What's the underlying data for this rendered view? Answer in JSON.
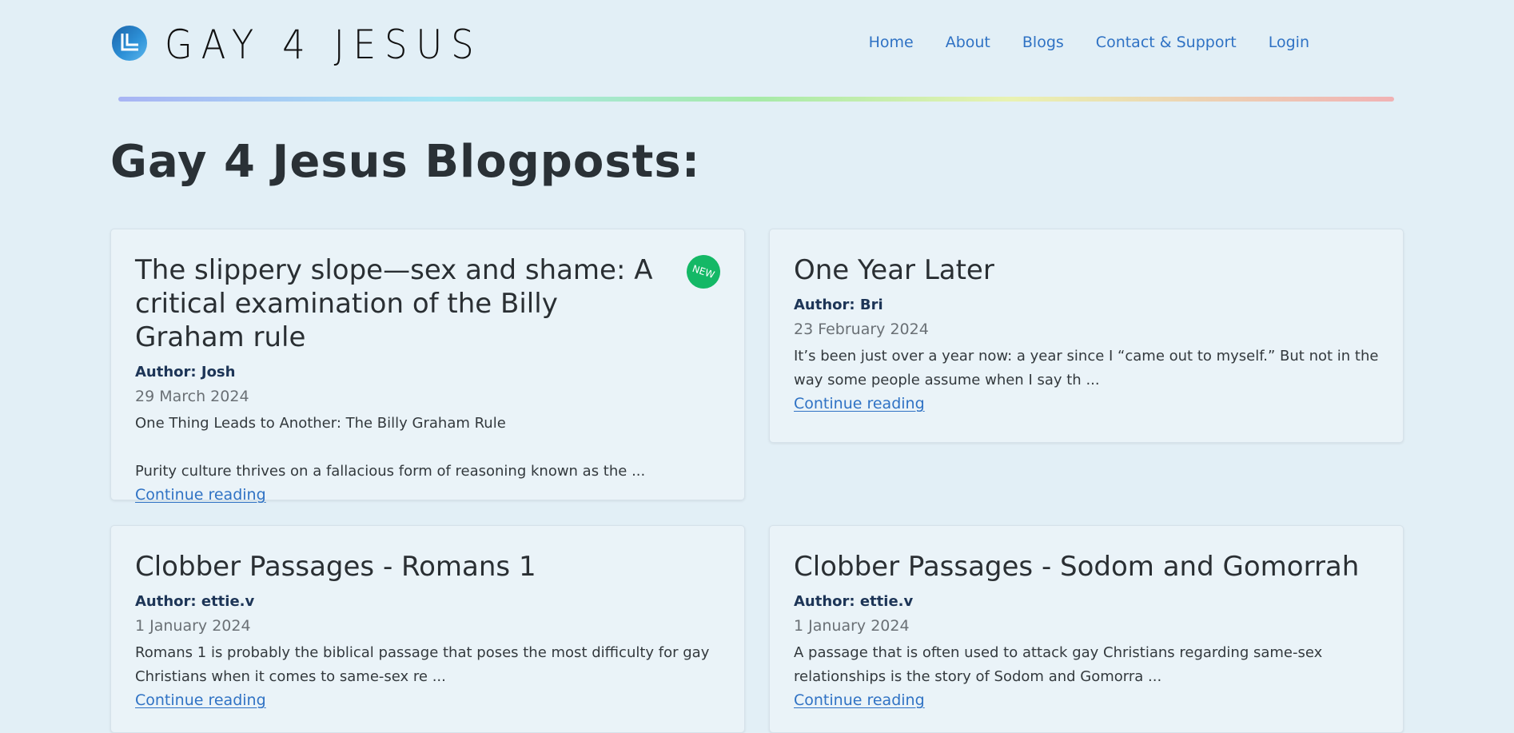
{
  "site": {
    "logo_text": "GAY 4 JESUS"
  },
  "nav": {
    "items": [
      {
        "label": "Home"
      },
      {
        "label": "About"
      },
      {
        "label": "Blogs"
      },
      {
        "label": "Contact & Support"
      },
      {
        "label": "Login"
      }
    ]
  },
  "page": {
    "title": "Gay 4 Jesus Blogposts:"
  },
  "posts": [
    {
      "title": "The slippery slope—sex and shame: A critical examination of the Billy Graham rule",
      "badge": "NEW",
      "author": "Author: Josh",
      "date": "29 March 2024",
      "excerpt": "One Thing Leads to Another: The Billy Graham Rule\n\nPurity culture thrives on a fallacious form of reasoning known as the ...",
      "link": "Continue reading"
    },
    {
      "title": "One Year Later",
      "author": "Author: Bri",
      "date": "23 February 2024",
      "excerpt": "It’s been just over a year now: a year since I “came out to myself.” But not in the way some people assume when I say th ...",
      "link": "Continue reading"
    },
    {
      "title": "Clobber Passages - Romans 1",
      "author": "Author: ettie.v",
      "date": "1 January 2024",
      "excerpt": "Romans 1 is probably the biblical passage that poses the most difficulty for gay Christians when it comes to same-sex re ...",
      "link": "Continue reading"
    },
    {
      "title": "Clobber Passages - Sodom and Gomorrah",
      "author": "Author: ettie.v",
      "date": "1 January 2024",
      "excerpt": "A passage that is often used to attack gay Christians regarding same-sex relationships is the story of Sodom and Gomorra ...",
      "link": "Continue reading"
    }
  ],
  "colors": {
    "background": "#e2eff6",
    "link": "#2f72c4",
    "author": "#1d3557",
    "badge": "#14b866"
  },
  "icons": {
    "logo": "logo-icon"
  }
}
